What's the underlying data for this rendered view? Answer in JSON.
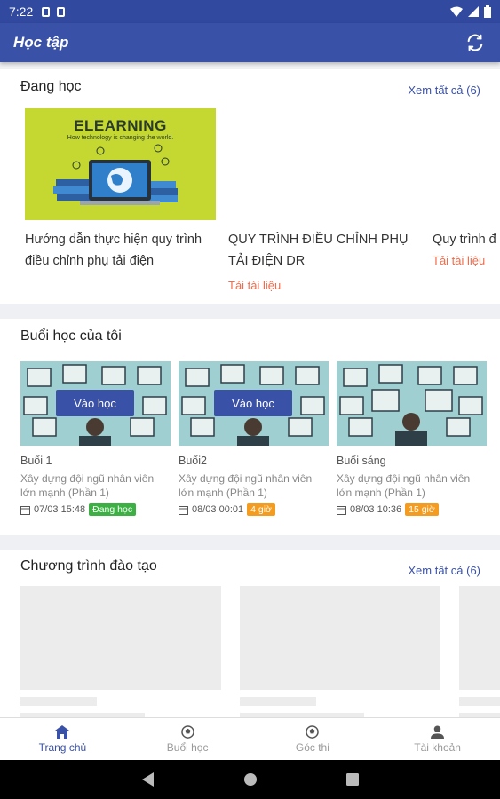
{
  "status_bar": {
    "time": "7:22"
  },
  "header": {
    "title": "Học tập"
  },
  "studying": {
    "title": "Đang học",
    "see_all": "Xem tất cả (6)",
    "banner": {
      "heading": "ELEARNING",
      "subtitle": "How technology is changing the world."
    },
    "courses": [
      {
        "name": "Hướng dẫn thực hiện quy trình điều chỉnh phụ tải điện",
        "link": ""
      },
      {
        "name": "QUY TRÌNH ĐIỀU CHỈNH PHỤ TẢI ĐIỆN DR",
        "link": "Tải tài liệu"
      },
      {
        "name": "Quy trình đ",
        "link": "Tải tài liệu"
      }
    ]
  },
  "sessions": {
    "title": "Buổi học của tôi",
    "join_label": "Vào học",
    "items": [
      {
        "name": "Buổi 1",
        "desc": "Xây dựng đội ngũ nhân viên lớn mạnh (Phần 1)",
        "time": "07/03 15:48",
        "badge": "Đang học",
        "badge_color": "#3cb043"
      },
      {
        "name": "Buổi2",
        "desc": "Xây dựng đội ngũ nhân viên lớn mạnh (Phần 1)",
        "time": "08/03 00:01",
        "badge": "4 giờ",
        "badge_color": "#f39c1f"
      },
      {
        "name": "Buổi sáng",
        "desc": "Xây dựng đội ngũ nhân viên lớn mạnh (Phần 1)",
        "time": "08/03 10:36",
        "badge": "15 giờ",
        "badge_color": "#f39c1f"
      }
    ]
  },
  "programs": {
    "title": "Chương trình đào tạo",
    "see_all": "Xem tất cả (6)"
  },
  "bottom_nav": [
    {
      "label": "Trang chủ",
      "icon": "home-icon",
      "active": true
    },
    {
      "label": "Buổi học",
      "icon": "ball-icon",
      "active": false
    },
    {
      "label": "Góc thi",
      "icon": "ball-icon",
      "active": false
    },
    {
      "label": "Tài khoản",
      "icon": "person-icon",
      "active": false
    }
  ],
  "colors": {
    "primary": "#3a51a8",
    "link_orange": "#f26b4b"
  }
}
